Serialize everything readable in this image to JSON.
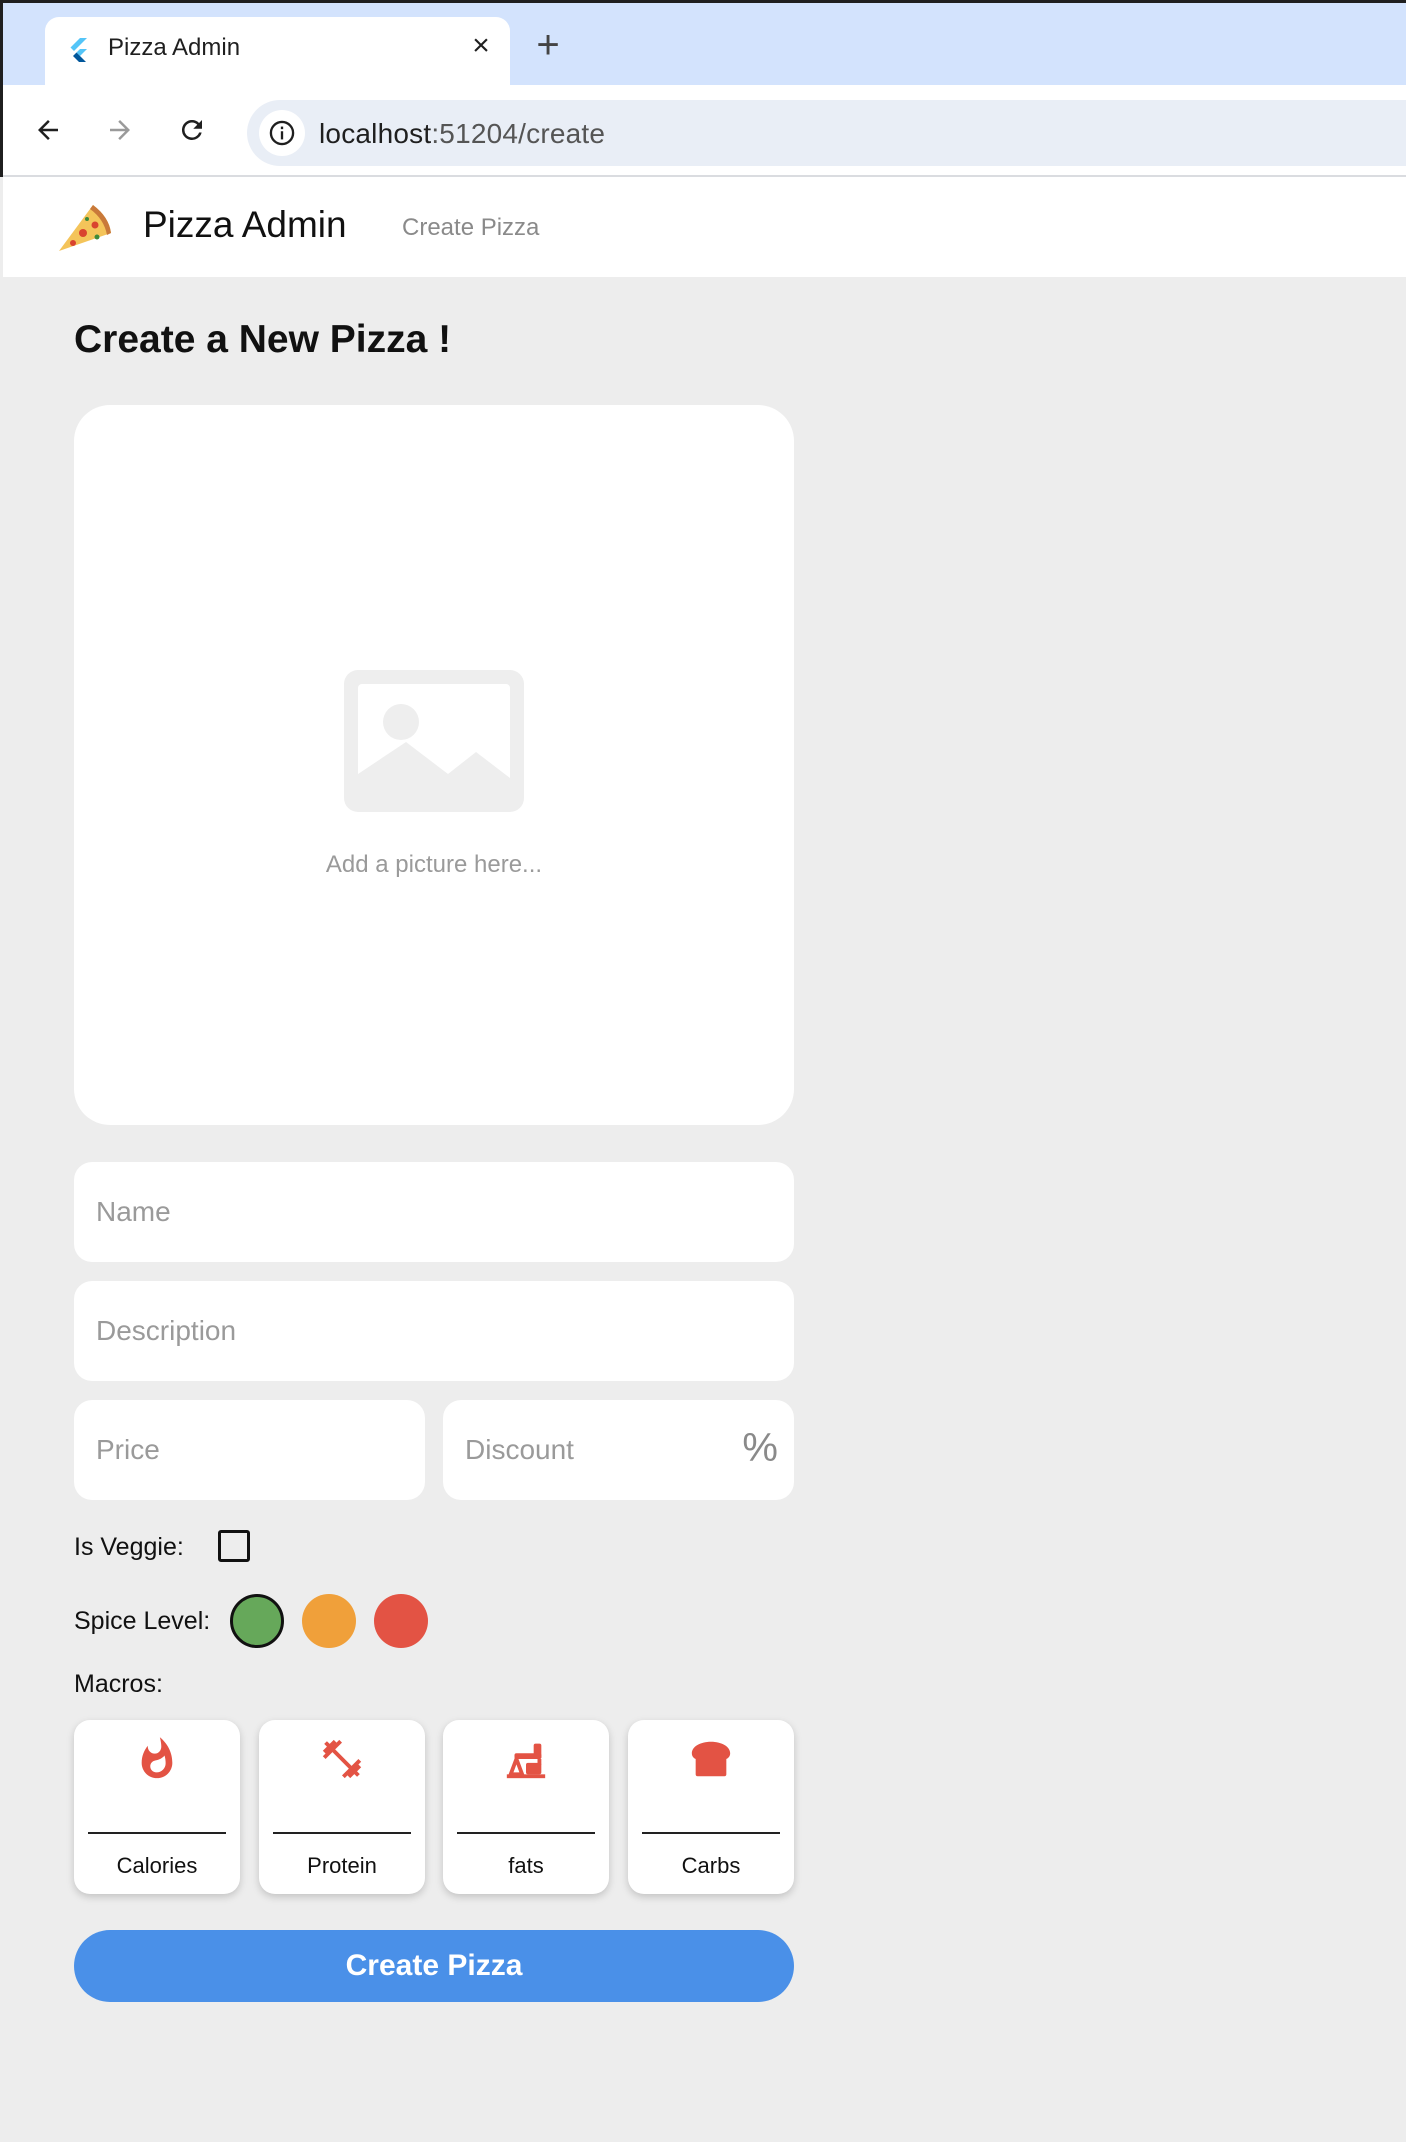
{
  "browser": {
    "tab_title": "Pizza Admin",
    "url_host": "localhost",
    "url_rest": ":51204/create"
  },
  "app": {
    "title": "Pizza Admin",
    "nav_link": "Create Pizza"
  },
  "form": {
    "heading": "Create a New Pizza !",
    "image_hint": "Add a picture here...",
    "name_placeholder": "Name",
    "description_placeholder": "Description",
    "price_placeholder": "Price",
    "discount_placeholder": "Discount",
    "discount_suffix": "%",
    "veggie_label": "Is Veggie:",
    "veggie_checked": false,
    "spice_label": "Spice Level:",
    "spice_levels": [
      {
        "color": "#66a85a",
        "selected": true
      },
      {
        "color": "#f0a03a",
        "selected": false
      },
      {
        "color": "#e35344",
        "selected": false
      }
    ],
    "macros_label": "Macros:",
    "macros": [
      {
        "label": "Calories",
        "icon": "fire-icon"
      },
      {
        "label": "Protein",
        "icon": "dumbbell-icon"
      },
      {
        "label": "fats",
        "icon": "oil-pump-icon"
      },
      {
        "label": "Carbs",
        "icon": "bread-icon"
      }
    ],
    "submit_label": "Create Pizza"
  },
  "colors": {
    "accent": "#4a90e8",
    "macro_icon": "#e35344",
    "background": "#ededed"
  }
}
